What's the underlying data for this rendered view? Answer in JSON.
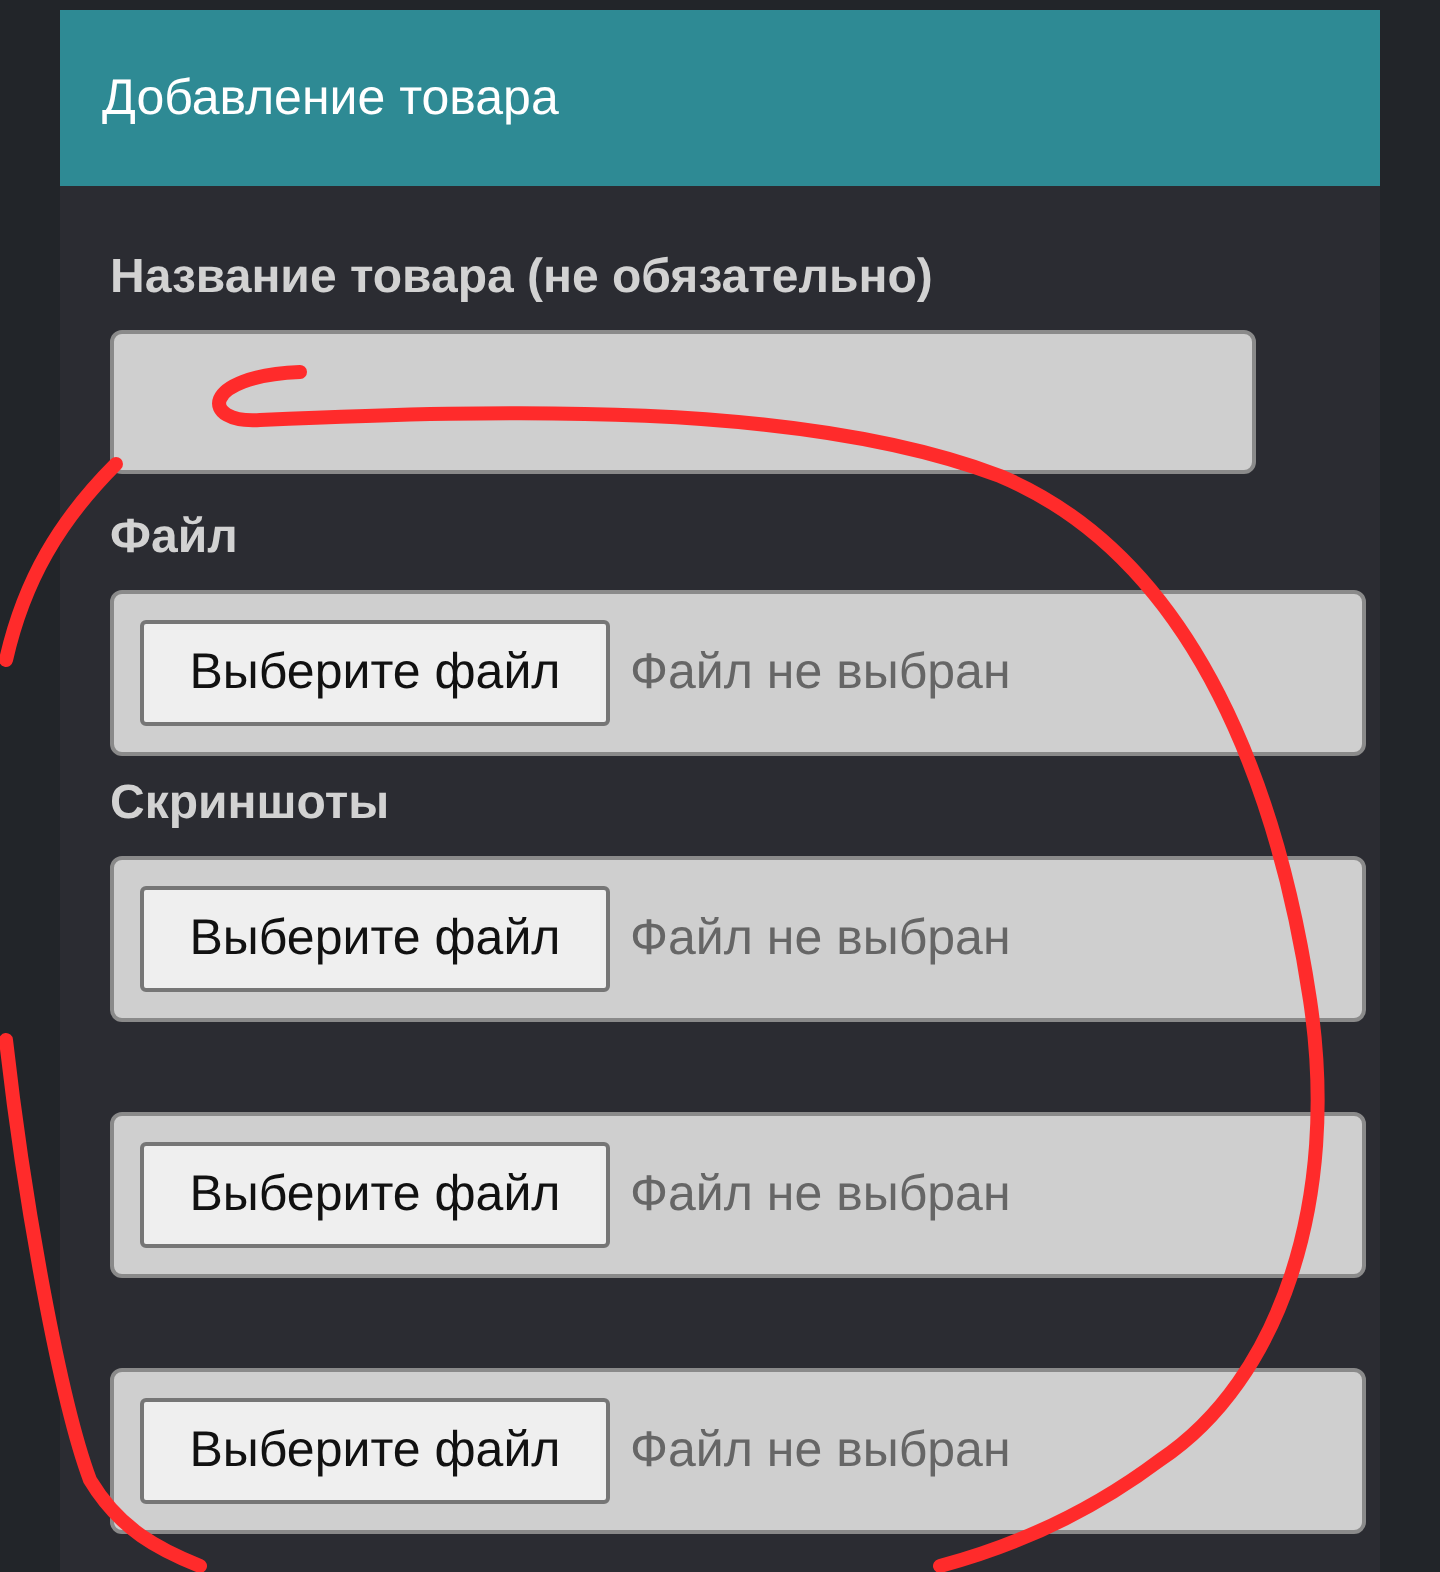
{
  "header": {
    "title": "Добавление товара"
  },
  "sections": [
    {
      "label": "Название товара (не обязательно)",
      "inputs": [
        {
          "kind": "text"
        }
      ]
    },
    {
      "label": "Файл",
      "inputs": [
        {
          "kind": "file",
          "button": "Выберите файл",
          "status": "Файл не выбран"
        }
      ]
    },
    {
      "label": "Скриншоты",
      "inputs": [
        {
          "kind": "file",
          "button": "Выберите файл",
          "status": "Файл не выбран"
        },
        {
          "kind": "file",
          "button": "Выберите файл",
          "status": "Файл не выбран"
        },
        {
          "kind": "file",
          "button": "Выберите файл",
          "status": "Файл не выбран"
        }
      ]
    }
  ]
}
